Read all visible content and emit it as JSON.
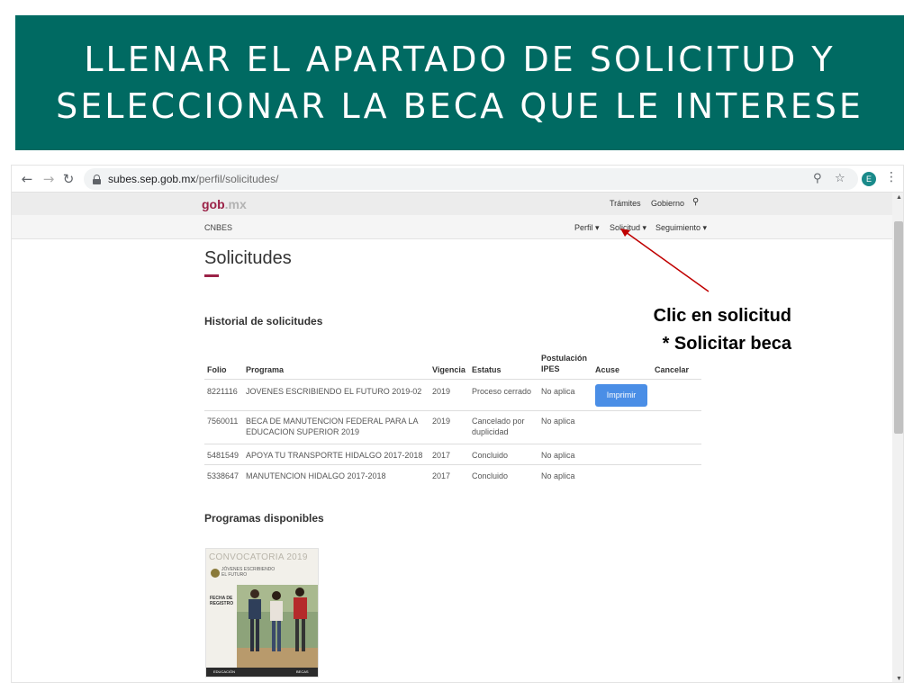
{
  "slide": {
    "title_line1": "LLENAR EL APARTADO DE SOLICITUD Y",
    "title_line2": "SELECCIONAR LA BECA QUE LE INTERESE"
  },
  "browser": {
    "url_host": "subes.sep.gob.mx",
    "url_path": "/perfil/solicitudes/",
    "avatar_initial": "E"
  },
  "site": {
    "logo_main": "gob",
    "logo_suffix": ".mx",
    "top_links": [
      "Trámites",
      "Gobierno"
    ],
    "brand": "CNBES",
    "menu": [
      "Perfil",
      "Solicitud",
      "Seguimiento"
    ]
  },
  "main": {
    "title": "Solicitudes",
    "history_heading": "Historial de solicitudes",
    "available_heading": "Programas disponibles",
    "columns": [
      "Folio",
      "Programa",
      "Vigencia",
      "Estatus",
      "Postulación IPES",
      "Acuse",
      "Cancelar"
    ],
    "rows": [
      {
        "folio": "8221116",
        "programa": "JOVENES ESCRIBIENDO EL FUTURO 2019-02",
        "vigencia": "2019",
        "estatus": "Proceso cerrado",
        "ipes": "No aplica",
        "acuse": "Imprimir"
      },
      {
        "folio": "7560011",
        "programa": "BECA DE MANUTENCION FEDERAL PARA LA EDUCACION SUPERIOR 2019",
        "vigencia": "2019",
        "estatus": "Cancelado por duplicidad",
        "ipes": "No aplica",
        "acuse": ""
      },
      {
        "folio": "5481549",
        "programa": "APOYA TU TRANSPORTE HIDALGO 2017-2018",
        "vigencia": "2017",
        "estatus": "Concluido",
        "ipes": "No aplica",
        "acuse": ""
      },
      {
        "folio": "5338647",
        "programa": "MANUTENCION HIDALGO 2017-2018",
        "vigencia": "2017",
        "estatus": "Concluido",
        "ipes": "No aplica",
        "acuse": ""
      }
    ],
    "program_card": {
      "title": "CONVOCATORIA 2019",
      "subtitle": "JÓVENES ESCRIBIENDO EL FUTURO",
      "label": "FECHA DE REGISTRO",
      "footer_left": "EDUCACIÓN",
      "footer_right": "BECAS"
    }
  },
  "annotation": {
    "line1": "Clic en solicitud",
    "line2": "* Solicitar beca",
    "color": "#c00000"
  },
  "colors": {
    "header_bg": "#006a62",
    "accent": "#9b2247",
    "button": "#4a8ee6"
  }
}
